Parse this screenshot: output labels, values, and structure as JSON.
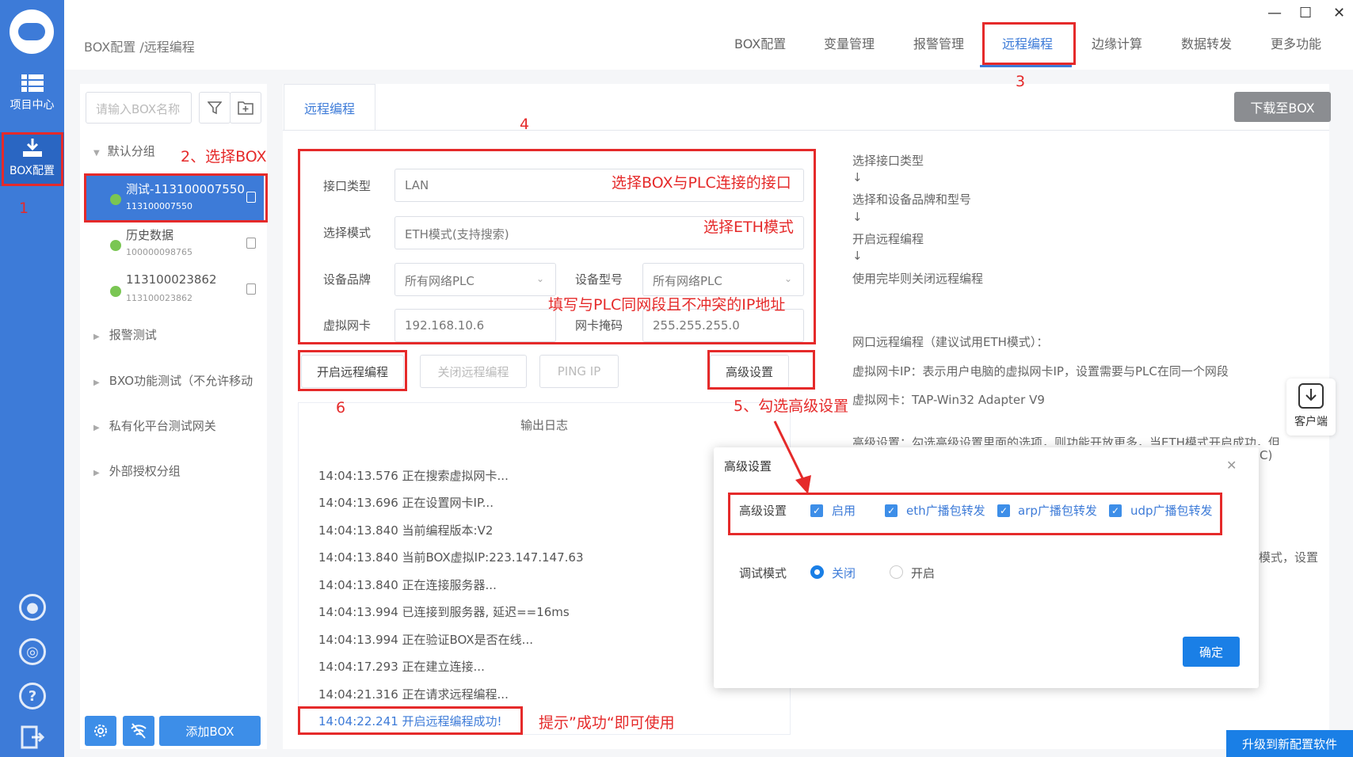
{
  "rail": {
    "project_center": "项目中心",
    "box_config": "BOX配置"
  },
  "header": {
    "breadcrumb": "BOX配置 /远程编程",
    "nav": [
      "BOX配置",
      "变量管理",
      "报警管理",
      "远程编程",
      "边缘计算",
      "数据转发",
      "更多功能"
    ],
    "active_nav": "远程编程"
  },
  "sidebar": {
    "search_placeholder": "请输入BOX名称",
    "groups": [
      "默认分组",
      "报警测试",
      "BXO功能测试（不允许移动",
      "私有化平台测试网关",
      "外部授权分组"
    ],
    "devices": [
      {
        "name": "测试-113100007550",
        "sub": "113100007550"
      },
      {
        "name": "历史数据",
        "sub": "100000098765"
      },
      {
        "name": "113100023862",
        "sub": "113100023862"
      }
    ],
    "add_box": "添加BOX"
  },
  "main": {
    "tab": "远程编程",
    "download": "下载至BOX",
    "form": {
      "interface_label": "接口类型",
      "interface_value": "LAN",
      "mode_label": "选择模式",
      "mode_value": "ETH模式(支持搜索)",
      "brand_label": "设备品牌",
      "brand_value": "所有网络PLC",
      "model_label": "设备型号",
      "model_value": "所有网络PLC",
      "vnic_label": "虚拟网卡",
      "vnic_value": "192.168.10.6",
      "mask_label": "网卡掩码",
      "mask_value": "255.255.255.0"
    },
    "buttons": {
      "start": "开启远程编程",
      "stop": "关闭远程编程",
      "ping": "PING IP",
      "advanced": "高级设置"
    },
    "log_title": "输出日志",
    "log": [
      "14:04:13.576 正在搜索虚拟网卡...",
      "14:04:13.696 正在设置网卡IP...",
      "14:04:13.840 当前编程版本:V2",
      "14:04:13.840 当前BOX虚拟IP:223.147.147.63",
      "14:04:13.840 正在连接服务器...",
      "14:04:13.994 已连接到服务器, 延迟==16ms",
      "14:04:13.994 正在验证BOX是否在线...",
      "14:04:17.293 正在建立连接...",
      "14:04:21.316 正在请求远程编程...",
      "14:04:22.241 开启远程编程成功!"
    ]
  },
  "help": {
    "steps": [
      "选择接口类型",
      "↓",
      "选择和设备品牌和型号",
      "↓",
      "开启远程编程",
      "↓",
      "使用完毕则关闭远程编程"
    ],
    "p1": "网口远程编程（建议试用ETH模式）：",
    "p2": "虚拟网卡IP：表示用户电脑的虚拟网卡IP，设置需要与PLC在同一个网段",
    "p3": "虚拟网卡：TAP-Win32 Adapter V9",
    "p4": "高级设置：勾选高级设置里面的选项，则功能开放更多，当ETH模式开启成功，但",
    "p4b": "C)",
    "p5": "模式，设置"
  },
  "dialog": {
    "title": "高级设置",
    "adv_label": "高级设置",
    "opts": [
      "启用",
      "eth广播包转发",
      "arp广播包转发",
      "udp广播包转发"
    ],
    "debug_label": "调试模式",
    "debug_off": "关闭",
    "debug_on": "开启",
    "ok": "确定"
  },
  "client": "客户端",
  "upgrade": "升级到新配置软件",
  "annotations": {
    "a1": "1",
    "a2": "2、选择BOX",
    "a3": "3",
    "a4": "4",
    "a5": "5、勾选高级设置",
    "a6": "6",
    "iface": "选择BOX与PLC连接的接口",
    "eth": "选择ETH模式",
    "ip": "填写与PLC同网段且不冲突的IP地址",
    "ok": "提示”成功“即可使用"
  },
  "colors": {
    "accent": "#3d7bd8",
    "annotation": "#e52a2a",
    "status_online": "#7ac653"
  }
}
